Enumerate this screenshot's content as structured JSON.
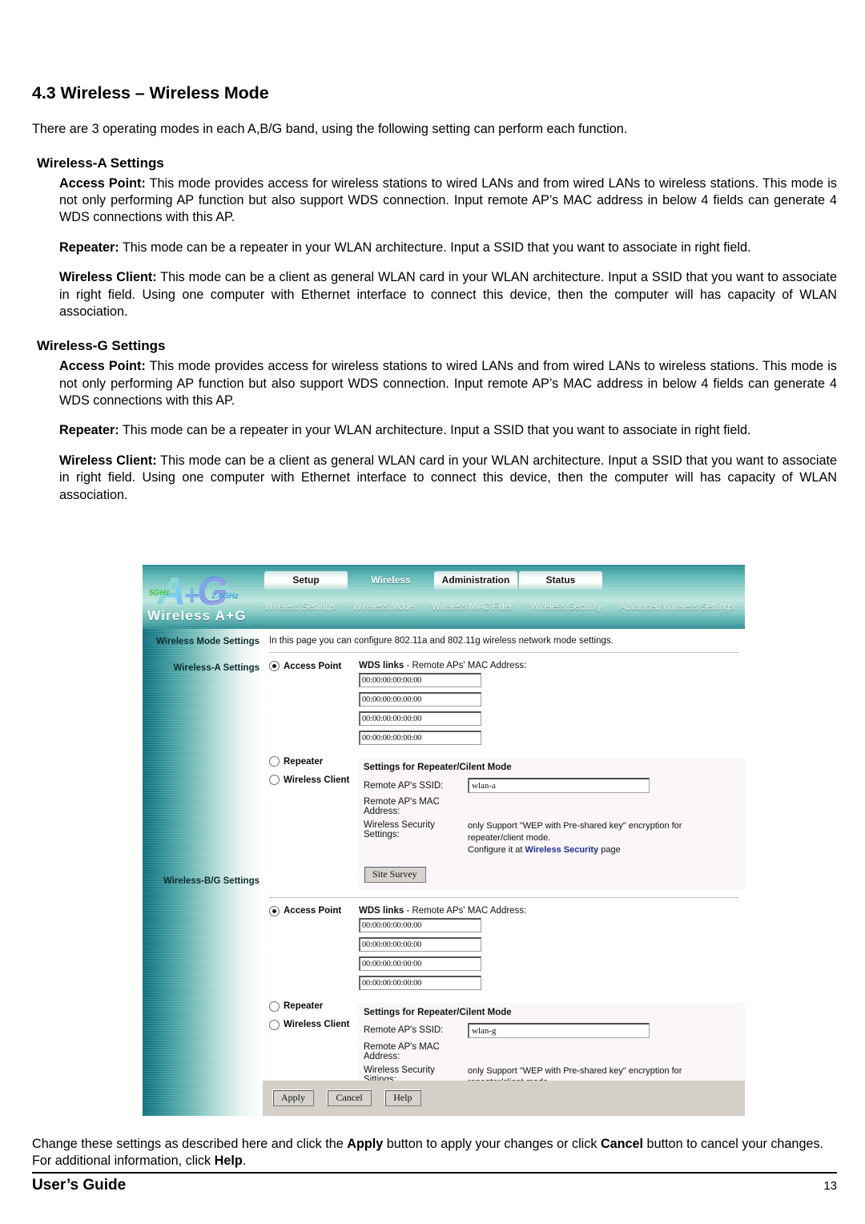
{
  "document": {
    "section_title": "4.3 Wireless – Wireless Mode",
    "lead": "There are 3 operating modes in each A,B/G band, using the following setting can perform each function.",
    "wireless_a_heading": "Wireless-A Settings",
    "wireless_g_heading": "Wireless-G Settings",
    "access_point_label": "Access Point:",
    "access_point_text_a": " This mode provides access for wireless stations to wired LANs and from wired LANs to wireless stations. This mode is not only performing AP function but also support WDS connection. Input remote AP’s MAC address in below 4 fields can generate 4 WDS connections with this AP.",
    "repeater_label": "Repeater:",
    "repeater_text": " This mode can be a repeater in your WLAN architecture. Input a SSID that you want to associate in right field.",
    "wireless_client_label": "Wireless Client:",
    "wireless_client_text": " This mode can be a client as general WLAN card in your WLAN architecture. Input a SSID that you want to associate in right field. Using one computer with Ethernet interface to connect this device, then the computer will has capacity of WLAN association.",
    "access_point_text_g": " This mode provides access for wireless stations to wired LANs and from wired LANs to wireless stations. This mode is not only performing AP function but also support WDS connection. Input remote AP’s MAC address in below 4 fields can generate 4 WDS connections with this AP."
  },
  "footer": {
    "note_part1": "Change these settings as described here and click the ",
    "note_apply": "Apply",
    "note_part2": " button to apply your changes or click ",
    "note_cancel": "Cancel",
    "note_part3": " button to cancel your changes. For additional information, click ",
    "note_help": "Help",
    "note_part4": ".",
    "guide_label": "User’s Guide",
    "page_number": "13"
  },
  "router_ui": {
    "logo": {
      "mark": "A G",
      "band_5ghz": "5GHz",
      "band_24ghz": "2.4GHz",
      "product_name": "Wireless A+G"
    },
    "tabs": [
      {
        "label": "Setup",
        "active": false
      },
      {
        "label": "Wireless",
        "active": true
      },
      {
        "label": "Administration",
        "active": false
      },
      {
        "label": "Status",
        "active": false
      }
    ],
    "subtabs": [
      "Wireless Settings",
      "Wireless Mode",
      "Wireless MAC Filter",
      "Wireless Security",
      "Advanced Wireless Settings"
    ],
    "side_labels": {
      "mode_settings": "Wireless Mode Settings",
      "wireless_a": "Wireless-A Settings",
      "wireless_bg": "Wireless-B/G Settings"
    },
    "intro": "In this page you can configure 802.11a and 802.11g wireless network mode settings.",
    "wds_title_bold": "WDS links",
    "wds_title_rest": " - Remote APs' MAC Address:",
    "radio_access_point": "Access Point",
    "radio_repeater": "Repeater",
    "radio_wireless_client": "Wireless Client",
    "rc_heading": "Settings for Repeater/Cilent Mode",
    "rc_ssid_label": "Remote AP's SSID:",
    "rc_mac_label": "Remote AP's MAC Address:",
    "site_survey_button": "Site Survey",
    "security_note_line2_pre": "Configure it at ",
    "security_note_link": "Wireless Security",
    "security_note_line2_post": " page",
    "security_note_line1": "only Support \"WEP with Pre-shared key\" encryption for repeater/client mode.",
    "link_color": "#1d2f96",
    "section_a": {
      "mac_fields": [
        "00:00:00:00:00:00",
        "00:00:00:00:00:00",
        "00:00:00:00:00:00",
        "00:00:00:00:00:00"
      ],
      "ssid_value": "wlan-a",
      "security_label": "Wireless Security Settings:",
      "selected_mode": "Access Point"
    },
    "section_bg": {
      "mac_fields": [
        "00:00:00:00:00:00",
        "00:00:00:00:00:00",
        "00:00:00:00:00:00",
        "00:00:00:00:00:00"
      ],
      "ssid_value": "wlan-g",
      "security_label": "Wireless Security Sittings:",
      "selected_mode": "Access Point"
    },
    "action_buttons": [
      "Apply",
      "Cancel",
      "Help"
    ]
  }
}
